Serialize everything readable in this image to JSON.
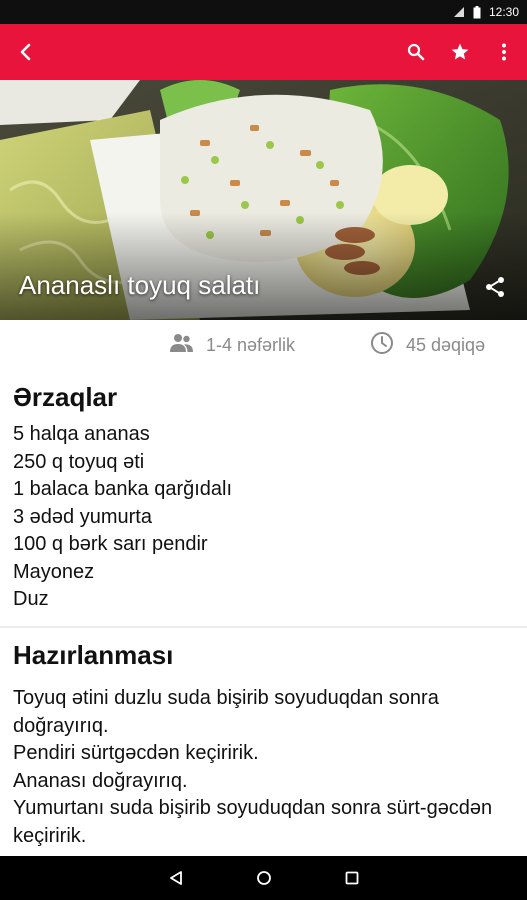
{
  "status_bar": {
    "time": "12:30"
  },
  "recipe": {
    "title": "Ananaslı toyuq salatı",
    "servings": "1-4 nəfərlik",
    "duration": "45 dəqiqə"
  },
  "ingredients": {
    "heading": "Ərzaqlar",
    "items": [
      "5 halqa ananas",
      "250 q toyuq əti",
      "1 balaca banka qarğıdalı",
      "3 ədəd yumurta",
      "100 q bərk sarı pendir",
      "Mayonez",
      "Duz"
    ]
  },
  "preparation": {
    "heading": "Hazırlanması",
    "lines": [
      "Toyuq ətini duzlu suda bişirib soyuduqdan sonra doğrayırıq.",
      "Pendiri sürtgəcdən keçiririk.",
      "Ananası doğrayırıq.",
      "Yumurtanı suda bişirib soyuduqdan sonra sürt-gəcdən keçiririk."
    ]
  },
  "icons": {
    "back": "arrow-back-icon",
    "search": "search-icon",
    "favorite": "star-icon",
    "more": "more-vert-icon",
    "share": "share-icon",
    "people": "people-icon",
    "clock": "clock-icon"
  },
  "colors": {
    "accent": "#e8143c",
    "meta_text": "#8a8a8a"
  }
}
